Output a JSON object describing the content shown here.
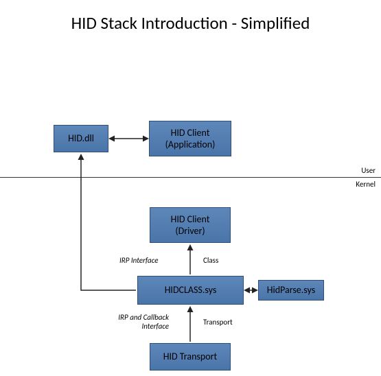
{
  "title": "HID Stack Introduction - Simplified",
  "boxes": {
    "hid_dll": "HID.dll",
    "hid_client_app": "HID Client\n(Application)",
    "hid_client_driver": "HID Client\n(Driver)",
    "hidclass_sys": "HIDCLASS.sys",
    "hidparse_sys": "HidParse.sys",
    "hid_transport": "HID Transport"
  },
  "labels": {
    "user": "User",
    "kernel": "Kernel",
    "class": "Class",
    "transport": "Transport",
    "irp_interface": "IRP Interface",
    "irp_callback": "IRP and Callback\nInterface"
  }
}
